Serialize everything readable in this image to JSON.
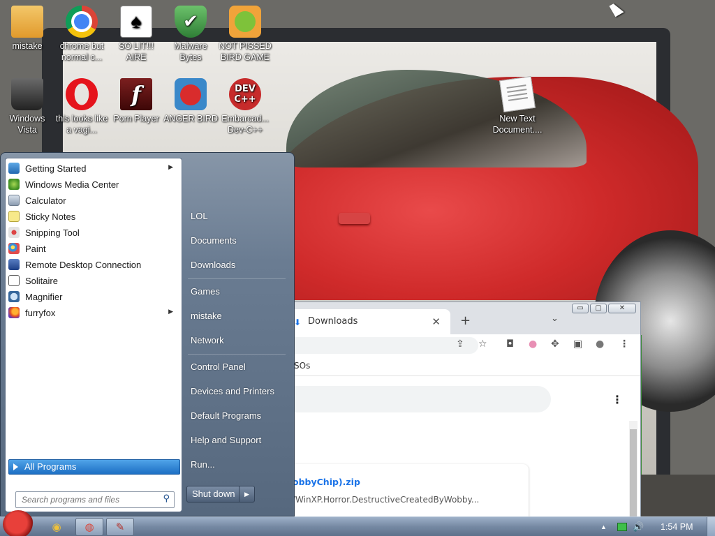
{
  "desktop": {
    "icons": [
      {
        "label": "mistake",
        "icon": "computer-folder-icon"
      },
      {
        "label": "chrome but normal c...",
        "icon": "chrome-icon"
      },
      {
        "label": "SO LIT!!! AIRE",
        "icon": "solitaire-icon"
      },
      {
        "label": "Malware Bytes",
        "icon": "shield-check-icon"
      },
      {
        "label": "NOT PISSED BIRD GAME",
        "icon": "green-pig-icon"
      },
      {
        "label": "Windows Vista",
        "icon": "recycle-bin-icon"
      },
      {
        "label": "this looks like a vagi...",
        "icon": "opera-icon"
      },
      {
        "label": "Porn Player",
        "icon": "flash-icon"
      },
      {
        "label": "ANGER BIRD",
        "icon": "angry-bird-icon"
      },
      {
        "label": "Embarcad... Dev-C++",
        "icon": "devcpp-icon"
      },
      {
        "label": "New Text Document....",
        "icon": "text-document-icon"
      }
    ],
    "glyphs": {
      "flash": "f",
      "dev": "DEV\nC++",
      "card": "♠",
      "check": "✔"
    }
  },
  "start_menu": {
    "programs": [
      {
        "label": "Getting Started",
        "icon": "getting-started-icon",
        "has_submenu": true
      },
      {
        "label": "Windows Media Center",
        "icon": "media-center-icon",
        "has_submenu": false
      },
      {
        "label": "Calculator",
        "icon": "calculator-icon",
        "has_submenu": false
      },
      {
        "label": "Sticky Notes",
        "icon": "sticky-notes-icon",
        "has_submenu": false
      },
      {
        "label": "Snipping Tool",
        "icon": "snipping-tool-icon",
        "has_submenu": false
      },
      {
        "label": "Paint",
        "icon": "paint-icon",
        "has_submenu": false
      },
      {
        "label": "Remote Desktop Connection",
        "icon": "remote-desktop-icon",
        "has_submenu": false
      },
      {
        "label": "Solitaire",
        "icon": "solitaire-icon",
        "has_submenu": false
      },
      {
        "label": "Magnifier",
        "icon": "magnifier-icon",
        "has_submenu": false
      },
      {
        "label": "furryfox",
        "icon": "firefox-icon",
        "has_submenu": true
      }
    ],
    "all_programs": "All Programs",
    "search_placeholder": "Search programs and files",
    "right_items": [
      "LOL",
      "Documents",
      "Downloads",
      "Games",
      "mistake",
      "Network",
      "Control Panel",
      "Devices and Printers",
      "Default Programs",
      "Help and Support",
      "Run..."
    ],
    "shutdown_label": "Shut down",
    "shutdown_arrow": "▶",
    "submenu_arrow": "▶",
    "search_icon_glyph": "⚲"
  },
  "browser": {
    "tab_title": "Downloads",
    "tab_close": "✕",
    "new_tab": "+",
    "tab_search": "⌄",
    "window_buttons": [
      "▭",
      "▢",
      "✕"
    ],
    "bookmark_fragment": "SOs",
    "download": {
      "file_name": "obbyChip).zip",
      "url_fragment": "/WinXP.Horror.DestructiveCreatedByWobby..."
    },
    "kebab": "⋮",
    "toolbar_icons": {
      "share": "⇪",
      "star": "☆",
      "ublock": "◘",
      "puzzle": "✥",
      "sidepanel": "▣",
      "profile": "●",
      "menu": "⋮"
    }
  },
  "taskbar": {
    "clock": "1:54 PM",
    "tray": {
      "up_arrow": "▲",
      "volume": "🔊"
    },
    "buttons": [
      {
        "name": "explorer",
        "glyph": "◉"
      },
      {
        "name": "chrome",
        "glyph": "◍"
      },
      {
        "name": "paint",
        "glyph": "✎"
      }
    ]
  },
  "colors": {
    "accent": "#1d6fc4",
    "taskbar": "#7689a3",
    "chrome_link": "#1a73e8"
  }
}
